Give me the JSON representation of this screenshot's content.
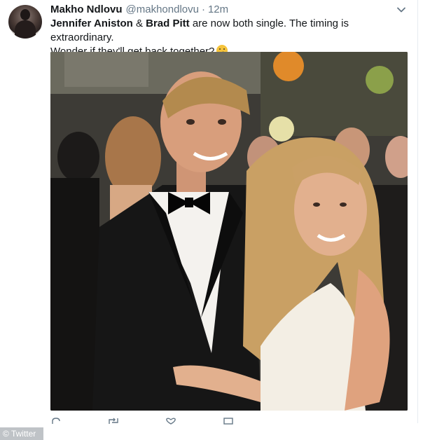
{
  "tweet": {
    "display_name": "Makho Ndlovu",
    "handle": "@makhondlovu",
    "separator": "·",
    "time": "12m",
    "text": {
      "name1": "Jennifer Aniston",
      "amp": " & ",
      "name2": "Brad Pitt",
      "rest1": " are now both single. The timing is extraordinary.",
      "rest2": "Wonder if they'll get back together?",
      "emoji": "thinking-face-emoji"
    },
    "icons": {
      "menu": "chevron-down-icon",
      "reply": "reply-icon",
      "retweet": "retweet-icon",
      "like": "heart-icon",
      "dm": "message-icon"
    }
  },
  "watermark": {
    "label": "© Twitter"
  },
  "colors": {
    "text": "#14171a",
    "secondary": "#657786",
    "border": "#e6ecf0"
  }
}
